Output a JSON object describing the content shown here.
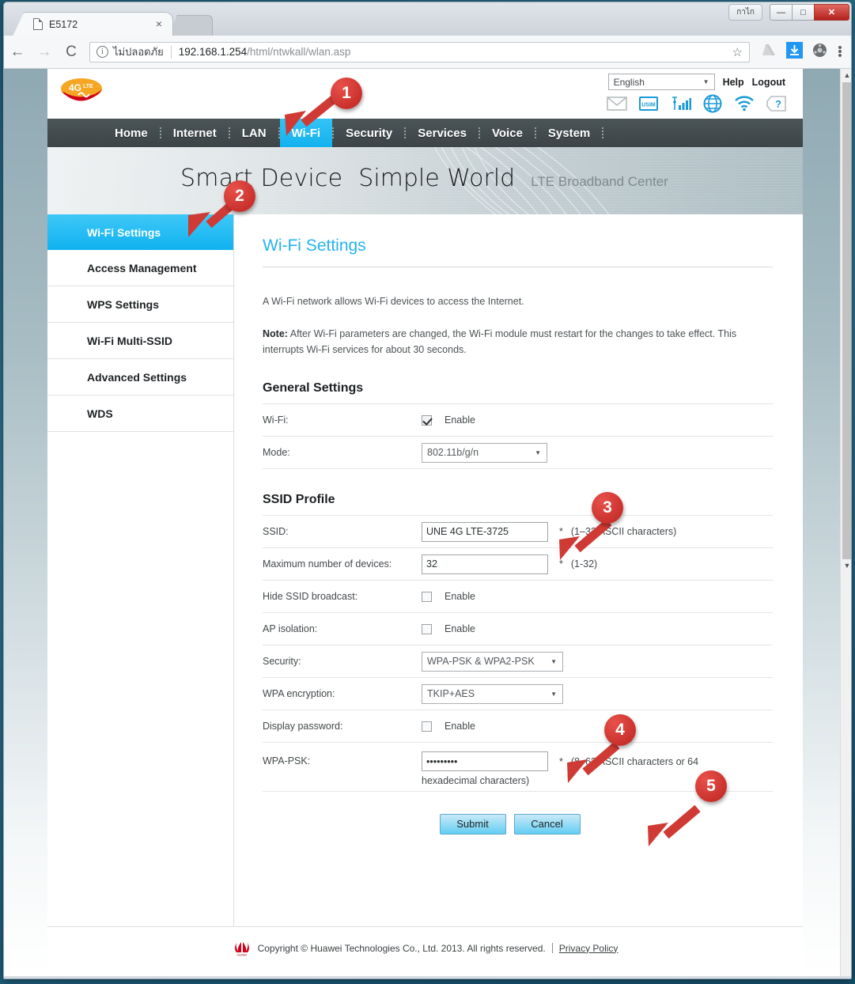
{
  "browser": {
    "tab_title": "E5172",
    "tab_close_glyph": "×",
    "back_glyph": "←",
    "forward_glyph": "→",
    "reload_glyph": "⟳",
    "insecure_label": "ไม่ปลอดภัย",
    "url_host": "192.168.1.254",
    "url_path": "/html/ntwkall/wlan.asp",
    "star_glyph": "☆",
    "menu_glyph": "⋮",
    "thai_ime_label": "กาไก",
    "win_minimize": "—",
    "win_maximize": "□",
    "win_close": "✕"
  },
  "page_header": {
    "logo_main": "4G",
    "logo_sup": "LTE",
    "language": "English",
    "help": "Help",
    "logout": "Logout",
    "icons": [
      "mail-icon",
      "usim-icon",
      "signal-icon",
      "globe-icon",
      "wifi-icon",
      "help-icon"
    ],
    "usim_text": "USIM"
  },
  "nav": {
    "items": [
      {
        "label": "Home",
        "active": false
      },
      {
        "label": "Internet",
        "active": false
      },
      {
        "label": "LAN",
        "active": false
      },
      {
        "label": "Wi-Fi",
        "active": true
      },
      {
        "label": "Security",
        "active": false
      },
      {
        "label": "Services",
        "active": false
      },
      {
        "label": "Voice",
        "active": false
      },
      {
        "label": "System",
        "active": false
      }
    ]
  },
  "banner": {
    "line1": "Smart Device",
    "line2": "Simple World",
    "subtitle": "LTE Broadband Center"
  },
  "sidebar": {
    "items": [
      {
        "label": "Wi-Fi Settings",
        "active": true
      },
      {
        "label": "Access Management",
        "active": false
      },
      {
        "label": "WPS Settings",
        "active": false
      },
      {
        "label": "Wi-Fi Multi-SSID",
        "active": false
      },
      {
        "label": "Advanced Settings",
        "active": false
      },
      {
        "label": "WDS",
        "active": false
      }
    ]
  },
  "content": {
    "title": "Wi-Fi Settings",
    "intro": "A Wi-Fi network allows Wi-Fi devices to access the Internet.",
    "note_label": "Note:",
    "note_text": " After Wi-Fi parameters are changed, the Wi-Fi module must restart for the changes to take effect. This interrupts Wi-Fi services for about 30 seconds.",
    "general_title": "General Settings",
    "ssid_title": "SSID Profile",
    "fields": {
      "wifi_label": "Wi-Fi:",
      "wifi_enable": "Enable",
      "mode_label": "Mode:",
      "mode_value": "802.11b/g/n",
      "ssid_label": "SSID:",
      "ssid_value": "UNE 4G LTE-3725",
      "ssid_hint": "(1–32 ASCII characters)",
      "maxdev_label": "Maximum number of devices:",
      "maxdev_value": "32",
      "maxdev_hint": "(1-32)",
      "hide_label": "Hide SSID broadcast:",
      "hide_enable": "Enable",
      "apiso_label": "AP isolation:",
      "apiso_enable": "Enable",
      "security_label": "Security:",
      "security_value": "WPA-PSK & WPA2-PSK",
      "wpaenc_label": "WPA encryption:",
      "wpaenc_value": "TKIP+AES",
      "disppw_label": "Display password:",
      "disppw_enable": "Enable",
      "wpapsk_label": "WPA-PSK:",
      "wpapsk_value": "•••••••••",
      "wpapsk_hint": "(8–63 ASCII characters or 64",
      "wpapsk_hint2": "hexadecimal characters)",
      "required_star": "*"
    },
    "submit": "Submit",
    "cancel": "Cancel"
  },
  "footer": {
    "copyright": "Copyright © Huawei Technologies Co., Ltd. 2013. All rights reserved.",
    "privacy": "Privacy Policy"
  },
  "markers": [
    {
      "n": "1"
    },
    {
      "n": "2"
    },
    {
      "n": "3"
    },
    {
      "n": "4"
    },
    {
      "n": "5"
    }
  ]
}
